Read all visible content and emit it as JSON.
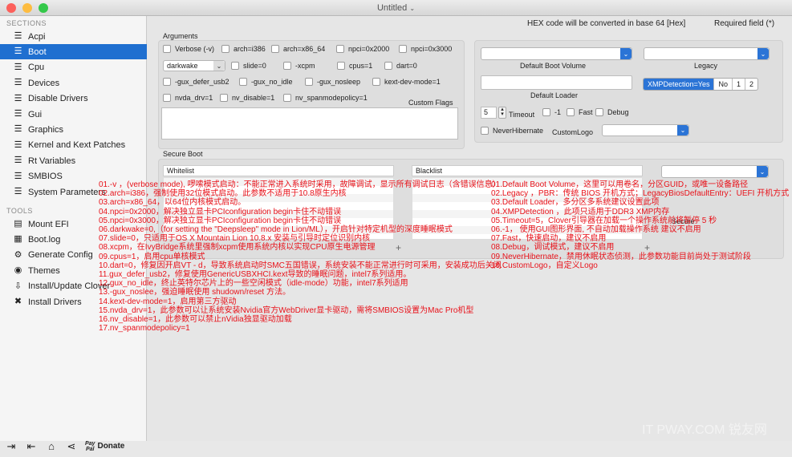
{
  "window": {
    "title": "Untitled"
  },
  "sidebar": {
    "sections_header": "SECTIONS",
    "items": [
      {
        "label": "Acpi",
        "icon": "list-icon"
      },
      {
        "label": "Boot",
        "icon": "list-icon"
      },
      {
        "label": "Cpu",
        "icon": "list-icon"
      },
      {
        "label": "Devices",
        "icon": "list-icon"
      },
      {
        "label": "Disable Drivers",
        "icon": "list-icon"
      },
      {
        "label": "Gui",
        "icon": "list-icon"
      },
      {
        "label": "Graphics",
        "icon": "list-icon"
      },
      {
        "label": "Kernel and Kext Patches",
        "icon": "list-icon"
      },
      {
        "label": "Rt Variables",
        "icon": "list-icon"
      },
      {
        "label": "SMBIOS",
        "icon": "list-icon"
      },
      {
        "label": "System Parameters",
        "icon": "list-icon"
      }
    ],
    "tools_header": "TOOLS",
    "tools": [
      {
        "label": "Mount EFI",
        "icon": "disk-icon"
      },
      {
        "label": "Boot.log",
        "icon": "document-icon"
      },
      {
        "label": "Generate Config",
        "icon": "gear-icon"
      },
      {
        "label": "Themes",
        "icon": "eye-icon"
      },
      {
        "label": "Install/Update Clover",
        "icon": "download-icon"
      },
      {
        "label": "Install Drivers",
        "icon": "wrench-icon"
      }
    ],
    "bottom": {
      "donate_label": "Donate",
      "paypal_line1": "Pay",
      "paypal_line2": "Pal"
    }
  },
  "header": {
    "note": "HEX code will be converted in base 64 [Hex]",
    "required": "Required field (*)"
  },
  "arguments": {
    "title": "Arguments",
    "row1": [
      "Verbose (-v)",
      "arch=i386",
      "arch=x86_64",
      "npci=0x2000",
      "npci=0x3000"
    ],
    "darkwake_value": "darkwake",
    "row2": [
      "slide=0",
      "-xcpm",
      "cpus=1",
      "dart=0"
    ],
    "row3": [
      "-gux_defer_usb2",
      "-gux_no_idle",
      "-gux_nosleep",
      "kext-dev-mode=1"
    ],
    "row4": [
      "nvda_drv=1",
      "nv_disable=1",
      "nv_spanmodepolicy=1"
    ],
    "custom_flags": "Custom Flags"
  },
  "right_panel": {
    "default_boot_volume": "Default Boot Volume",
    "legacy": "Legacy",
    "default_loader": "Default Loader",
    "xmp_options": [
      "XMPDetection=Yes",
      "No",
      "1",
      "2"
    ],
    "timeout_value": "5",
    "timeout_label": "Timeout",
    "minus1": "-1",
    "fast": "Fast",
    "debug": "Debug",
    "never_hibernate": "NeverHibernate",
    "custom_logo": "CustomLogo"
  },
  "secure_boot": {
    "title": "Secure Boot",
    "whitelist": "Whitelist",
    "blacklist": "Blacklist",
    "secure": "Secure"
  },
  "annotations_left": [
    "01.-v ，(verbose mode), 啰嗦模式启动：不能正常进入系统时采用，故障调试，显示所有调试日志（含错误信息）",
    "02.arch=i386，强制使用32位模式启动。此参数不适用于10.8原生内核",
    "03.arch=x86_64，以64位内核模式启动。",
    "04.npci=0x2000，解决独立显卡PCIconfiguration begin卡住不动错误",
    "05.npci=0x3000，解决独立显卡PCIconfiguration begin卡住不动错误",
    "06.darkwake=0,（for setting the \"Deepsleep\" mode in Lion/ML），开启针对特定机型的深度睡眠模式",
    "07.slide=0，只适用于OS X Mountain Lion 10.8.x 安装与引导时定位识别内核",
    "08.xcpm，在IvyBridge系统里强制xcpm使用系统内核以实现CPU原生电源管理",
    "09.cpus=1，启用cpu单核模式",
    "10.dart=0，修复因开启VT - d，导致系统启动时SMC五国错误，系统安装不能正常进行时可采用，安装成功后关闭",
    "11.gux_defer_usb2，修复使用GenericUSBXHCI.kext导致的睡眠问题，intel7系列适用。",
    "12.gux_no_idle，终止英特尔芯片上的一些空闲模式（idle-mode）功能，intel7系列适用",
    "13.-gux_noslee，强迫睡眠使用 shudown/reset 方法。",
    "14.kext-dev-mode=1，启用第三方驱动",
    "15.nvda_drv=1，此参数可以让系统安装Nvidia官方WebDriver显卡驱动，需将SMBIOS设置为Mac Pro机型",
    "16.nv_disable=1，此参数可以禁止nVidia独显驱动加载",
    "17.nv_spanmodepolicy=1"
  ],
  "annotations_right": [
    "01.Default Boot Volume，这里可以用卷名，分区GUID，或唯一设备路径",
    "02.Legacy ，PBR：传统 BIOS 开机方式；LegacyBiosDefaultEntry：UEFI 开机方式",
    "03.Default Loader，多分区多系统建议设置此项",
    "04.XMPDetection ，此项只适用于DDR3 XMP内存",
    "05.Timeout=5，Clover引导器在加载一个操作系统前将暂停 5 秒",
    "06.-1， 使用GUI图形界面, 不自动加载操作系统 建议不启用",
    "07.Fast，快速启动，建议不启用",
    "08.Debug，调试模式，建议不启用",
    "09.NeverHibernate，禁用休眠状态侦测，此参数功能目前尚处于测试阶段",
    "10.CustomLogo，自定义Logo"
  ],
  "watermark": "IT PWAY.COM 锐友网"
}
